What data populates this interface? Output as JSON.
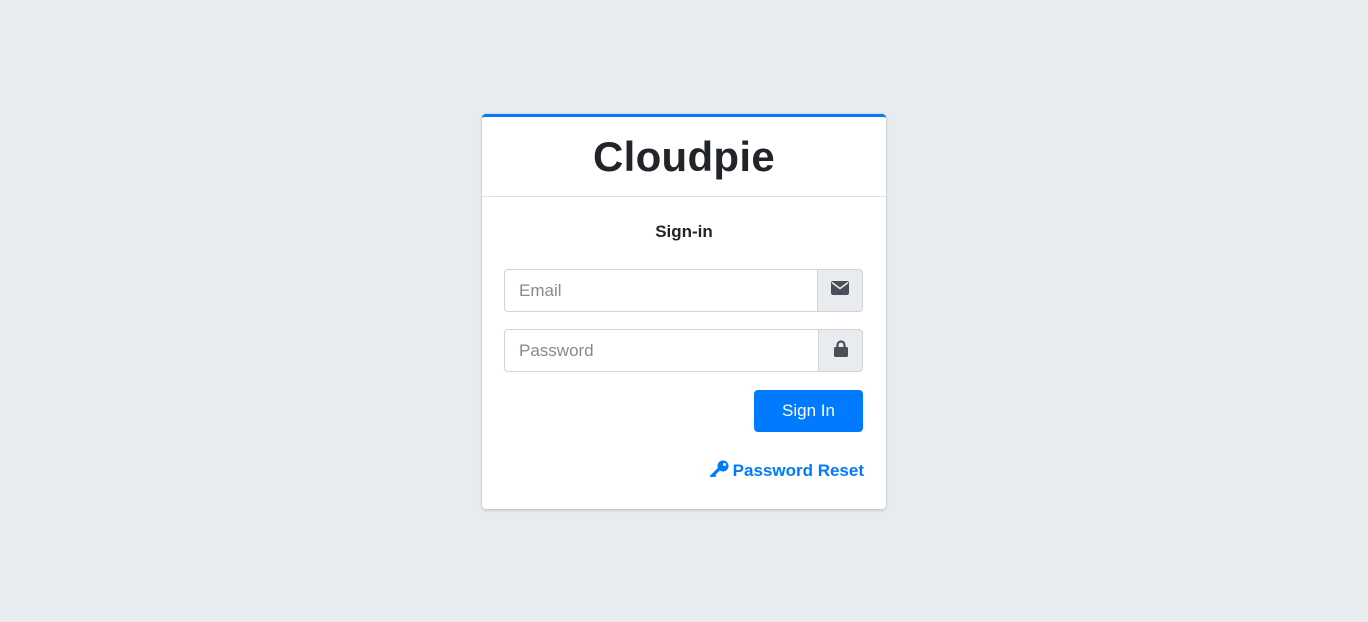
{
  "brand": {
    "title": "Cloudpie"
  },
  "login": {
    "message": "Sign-in",
    "email": {
      "placeholder": "Email",
      "value": "",
      "icon": "envelope-icon"
    },
    "password": {
      "placeholder": "Password",
      "value": "",
      "icon": "lock-icon"
    },
    "submit_label": "Sign In",
    "reset_link": {
      "label": "Password Reset",
      "icon": "key-icon"
    }
  },
  "colors": {
    "accent": "#007bff",
    "background": "#e9ecef",
    "text": "#212529"
  }
}
